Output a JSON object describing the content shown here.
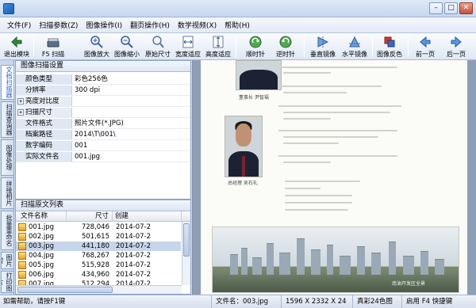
{
  "menu": [
    "文件(F)",
    "扫描参数(Z)",
    "图像操作(I)",
    "翻页操作(H)",
    "数学视频(X)",
    "帮助(H)"
  ],
  "toolbar": [
    {
      "label": "退出模块",
      "icon": "exit-icon"
    },
    {
      "label": "F5 扫描 ",
      "icon": "scanner-icon"
    },
    {
      "label": "图像放大",
      "icon": "zoom-in-icon"
    },
    {
      "label": "图像缩小",
      "icon": "zoom-out-icon"
    },
    {
      "label": "原始尺寸",
      "icon": "actual-size-icon"
    },
    {
      "label": "宽度适应",
      "icon": "fit-width-icon"
    },
    {
      "label": "高度适应",
      "icon": "fit-height-icon"
    },
    {
      "label": "顺时针",
      "icon": "rotate-cw-icon"
    },
    {
      "label": "逆时针",
      "icon": "rotate-ccw-icon"
    },
    {
      "label": "垂直镜像",
      "icon": "flip-vertical-icon"
    },
    {
      "label": "水平镜像",
      "icon": "flip-horizontal-icon"
    },
    {
      "label": "图像反色",
      "icon": "invert-color-icon"
    },
    {
      "label": "前一页",
      "icon": "prev-page-icon"
    },
    {
      "label": "后一页",
      "icon": "next-page-icon"
    }
  ],
  "side_tabs": [
    "文档扫描器",
    "扫描查询器",
    "图像处理",
    "拼接相片",
    "批量重命名",
    "图片转PDF",
    "打印图片"
  ],
  "settings": {
    "title": "图像扫描设置",
    "rows": [
      {
        "key": "颜色类型",
        "value": "彩色256色",
        "group": false
      },
      {
        "key": "分辨率",
        "value": "300 dpi",
        "group": false
      },
      {
        "key": "亮度对比度",
        "value": "",
        "group": true
      },
      {
        "key": "扫描尺寸",
        "value": "",
        "group": true
      },
      {
        "key": "文件格式",
        "value": "照片文件(*.JPG)",
        "group": false
      },
      {
        "key": "档案路径",
        "value": "2014\\T\\001\\",
        "group": false
      },
      {
        "key": "数字编码",
        "value": "001",
        "group": false
      },
      {
        "key": "实际文件名",
        "value": "001.jpg",
        "group": false
      }
    ]
  },
  "file_list": {
    "title": "扫描原文列表",
    "columns": [
      "文件名称",
      "尺寸",
      "创建"
    ],
    "rows": [
      {
        "name": "001.jpg",
        "size": "728,046",
        "created": "2014-07-2",
        "selected": false
      },
      {
        "name": "002.jpg",
        "size": "501,615",
        "created": "2014-07-2",
        "selected": false
      },
      {
        "name": "003.jpg",
        "size": "441,180",
        "created": "2014-07-2",
        "selected": true
      },
      {
        "name": "004.jpg",
        "size": "768,267",
        "created": "2014-07-2",
        "selected": false
      },
      {
        "name": "005.jpg",
        "size": "515,928",
        "created": "2014-07-2",
        "selected": false
      },
      {
        "name": "006.jpg",
        "size": "434,960",
        "created": "2014-07-2",
        "selected": false
      },
      {
        "name": "007.jpg",
        "size": "512,294",
        "created": "2014-07-2",
        "selected": false
      }
    ]
  },
  "document": {
    "caption1": "董事长 尹智福",
    "caption2": "总经理 吴石礼",
    "city_caption": "南油开发区全景"
  },
  "status": {
    "help": "如需帮助，请按F1键",
    "filename": "文件名：003.jpg",
    "dimensions": "1596 X 2332 X 24",
    "color": "真彩24色图",
    "shortcut": "启用 F4 快捷键"
  }
}
